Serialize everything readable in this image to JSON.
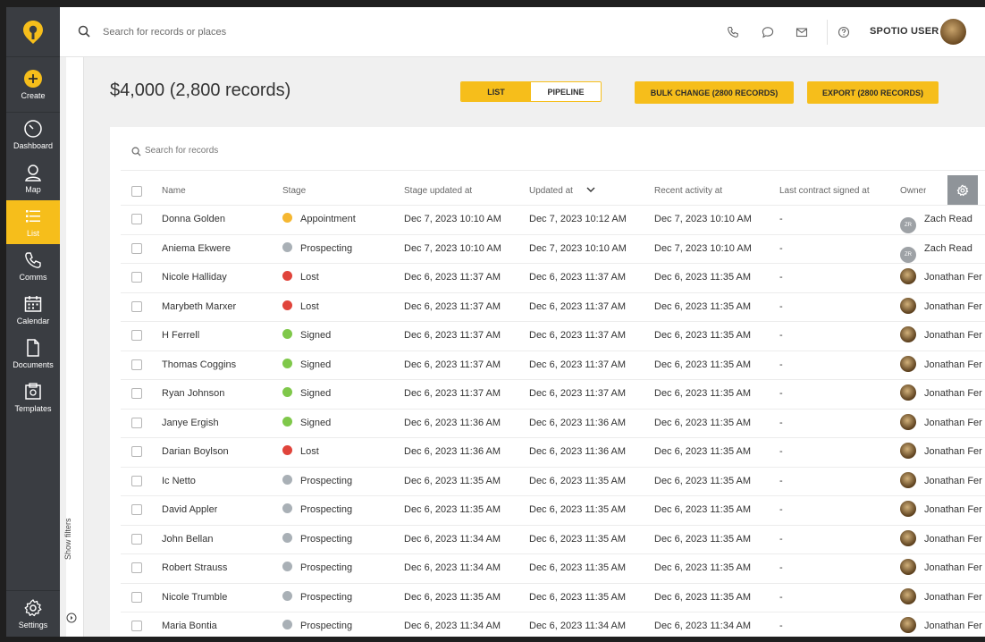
{
  "sidebar": {
    "items": [
      {
        "name": "create",
        "label": "Create"
      },
      {
        "name": "dashboard",
        "label": "Dashboard"
      },
      {
        "name": "map",
        "label": "Map"
      },
      {
        "name": "list",
        "label": "List"
      },
      {
        "name": "comms",
        "label": "Comms"
      },
      {
        "name": "calendar",
        "label": "Calendar"
      },
      {
        "name": "documents",
        "label": "Documents"
      },
      {
        "name": "templates",
        "label": "Templates"
      }
    ],
    "settings_label": "Settings"
  },
  "topbar": {
    "search_placeholder": "Search for records or places",
    "user_name": "SPOTIO USER"
  },
  "filters": {
    "label": "Show filters"
  },
  "header": {
    "summary": "$4,000 (2,800 records)",
    "view_list": "LIST",
    "view_pipeline": "PIPELINE",
    "bulk_change": "BULK CHANGE (2800 RECORDS)",
    "export": "EXPORT (2800 RECORDS)"
  },
  "table": {
    "search_placeholder": "Search for records",
    "columns": {
      "name": "Name",
      "stage": "Stage",
      "stage_updated": "Stage updated at",
      "updated": "Updated at",
      "recent_activity": "Recent activity at",
      "last_contract": "Last contract signed at",
      "owner": "Owner"
    },
    "stage_colors": {
      "Appointment": "#f5b731",
      "Prospecting": "#a9b0b6",
      "Lost": "#e0443b",
      "Signed": "#7fc84a"
    },
    "rows": [
      {
        "name": "Donna Golden",
        "stage": "Appointment",
        "stage_updated": "Dec 7, 2023 10:10 AM",
        "updated": "Dec 7, 2023 10:12 AM",
        "recent_activity": "Dec 7, 2023 10:10 AM",
        "last_contract": "-",
        "owner": "Zach Read",
        "owner_initials": "ZR"
      },
      {
        "name": "Aniema Ekwere",
        "stage": "Prospecting",
        "stage_updated": "Dec 7, 2023 10:10 AM",
        "updated": "Dec 7, 2023 10:10 AM",
        "recent_activity": "Dec 7, 2023 10:10 AM",
        "last_contract": "-",
        "owner": "Zach Read",
        "owner_initials": "ZR"
      },
      {
        "name": "Nicole Halliday",
        "stage": "Lost",
        "stage_updated": "Dec 6, 2023 11:37 AM",
        "updated": "Dec 6, 2023 11:37 AM",
        "recent_activity": "Dec 6, 2023 11:35 AM",
        "last_contract": "-",
        "owner": "Jonathan Fer",
        "owner_initials": ""
      },
      {
        "name": "Marybeth Marxer",
        "stage": "Lost",
        "stage_updated": "Dec 6, 2023 11:37 AM",
        "updated": "Dec 6, 2023 11:37 AM",
        "recent_activity": "Dec 6, 2023 11:35 AM",
        "last_contract": "-",
        "owner": "Jonathan Fer",
        "owner_initials": ""
      },
      {
        "name": "H Ferrell",
        "stage": "Signed",
        "stage_updated": "Dec 6, 2023 11:37 AM",
        "updated": "Dec 6, 2023 11:37 AM",
        "recent_activity": "Dec 6, 2023 11:35 AM",
        "last_contract": "-",
        "owner": "Jonathan Fer",
        "owner_initials": ""
      },
      {
        "name": "Thomas Coggins",
        "stage": "Signed",
        "stage_updated": "Dec 6, 2023 11:37 AM",
        "updated": "Dec 6, 2023 11:37 AM",
        "recent_activity": "Dec 6, 2023 11:35 AM",
        "last_contract": "-",
        "owner": "Jonathan Fer",
        "owner_initials": ""
      },
      {
        "name": "Ryan Johnson",
        "stage": "Signed",
        "stage_updated": "Dec 6, 2023 11:37 AM",
        "updated": "Dec 6, 2023 11:37 AM",
        "recent_activity": "Dec 6, 2023 11:35 AM",
        "last_contract": "-",
        "owner": "Jonathan Fer",
        "owner_initials": ""
      },
      {
        "name": "Janye Ergish",
        "stage": "Signed",
        "stage_updated": "Dec 6, 2023 11:36 AM",
        "updated": "Dec 6, 2023 11:36 AM",
        "recent_activity": "Dec 6, 2023 11:35 AM",
        "last_contract": "-",
        "owner": "Jonathan Fer",
        "owner_initials": ""
      },
      {
        "name": "Darian Boylson",
        "stage": "Lost",
        "stage_updated": "Dec 6, 2023 11:36 AM",
        "updated": "Dec 6, 2023 11:36 AM",
        "recent_activity": "Dec 6, 2023 11:35 AM",
        "last_contract": "-",
        "owner": "Jonathan Fer",
        "owner_initials": ""
      },
      {
        "name": "Ic Netto",
        "stage": "Prospecting",
        "stage_updated": "Dec 6, 2023 11:35 AM",
        "updated": "Dec 6, 2023 11:35 AM",
        "recent_activity": "Dec 6, 2023 11:35 AM",
        "last_contract": "-",
        "owner": "Jonathan Fer",
        "owner_initials": ""
      },
      {
        "name": "David Appler",
        "stage": "Prospecting",
        "stage_updated": "Dec 6, 2023 11:35 AM",
        "updated": "Dec 6, 2023 11:35 AM",
        "recent_activity": "Dec 6, 2023 11:35 AM",
        "last_contract": "-",
        "owner": "Jonathan Fer",
        "owner_initials": ""
      },
      {
        "name": "John Bellan",
        "stage": "Prospecting",
        "stage_updated": "Dec 6, 2023 11:34 AM",
        "updated": "Dec 6, 2023 11:35 AM",
        "recent_activity": "Dec 6, 2023 11:35 AM",
        "last_contract": "-",
        "owner": "Jonathan Fer",
        "owner_initials": ""
      },
      {
        "name": "Robert Strauss",
        "stage": "Prospecting",
        "stage_updated": "Dec 6, 2023 11:34 AM",
        "updated": "Dec 6, 2023 11:35 AM",
        "recent_activity": "Dec 6, 2023 11:35 AM",
        "last_contract": "-",
        "owner": "Jonathan Fer",
        "owner_initials": ""
      },
      {
        "name": "Nicole Trumble",
        "stage": "Prospecting",
        "stage_updated": "Dec 6, 2023 11:35 AM",
        "updated": "Dec 6, 2023 11:35 AM",
        "recent_activity": "Dec 6, 2023 11:35 AM",
        "last_contract": "-",
        "owner": "Jonathan Fer",
        "owner_initials": ""
      },
      {
        "name": "Maria Bontia",
        "stage": "Prospecting",
        "stage_updated": "Dec 6, 2023 11:34 AM",
        "updated": "Dec 6, 2023 11:34 AM",
        "recent_activity": "Dec 6, 2023 11:34 AM",
        "last_contract": "-",
        "owner": "Jonathan Fer",
        "owner_initials": ""
      }
    ]
  }
}
